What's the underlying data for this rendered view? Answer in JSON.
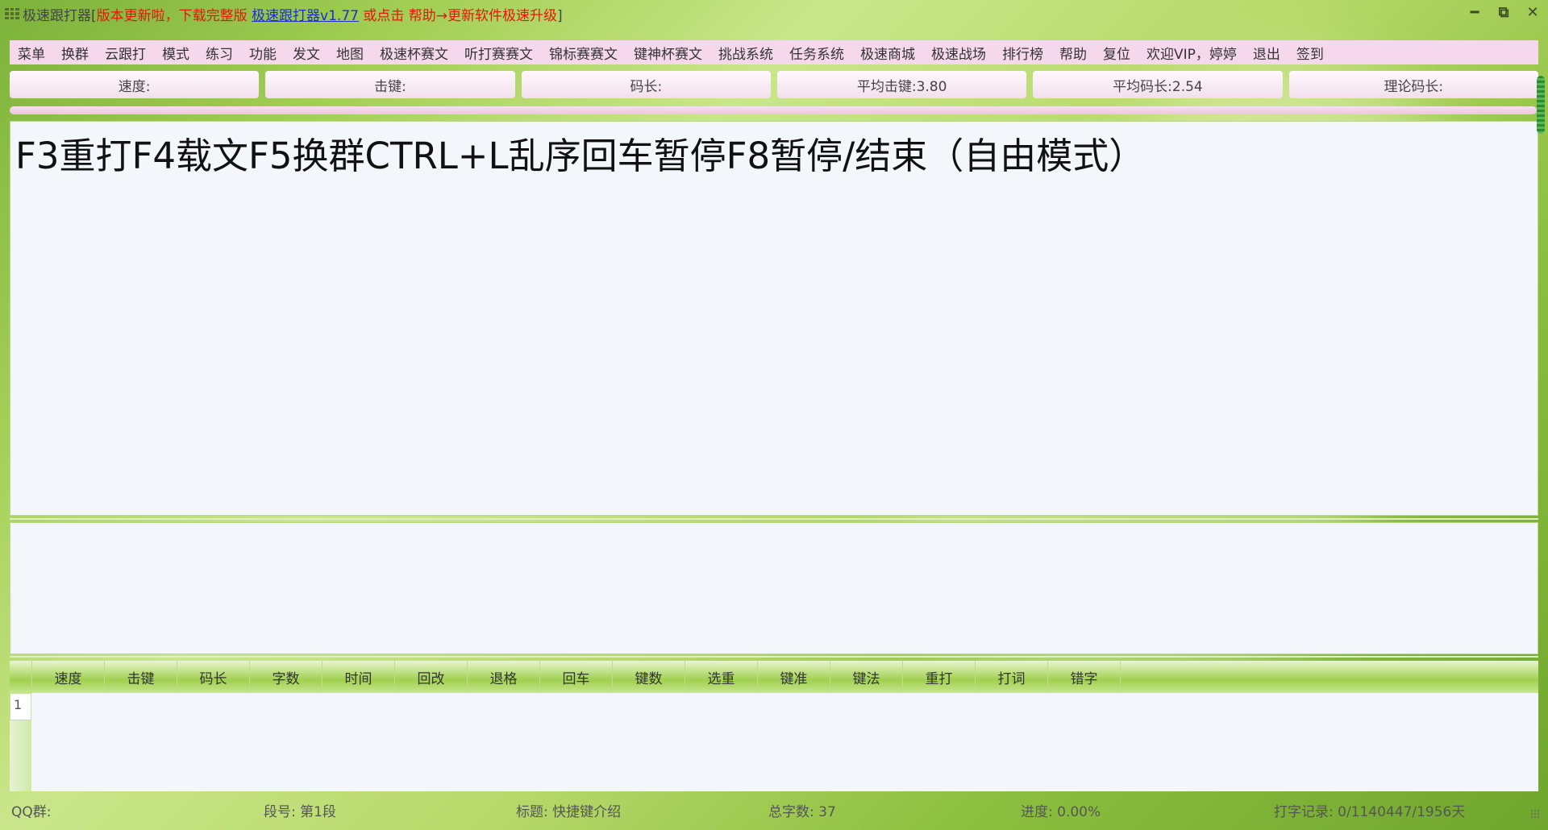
{
  "title": {
    "app": "极速跟打器",
    "bracket_open": "[",
    "notice": "版本更新啦，下载完整版",
    "link": "极速跟打器v1.77",
    "tail": "或点击 帮助→更新软件极速升级",
    "bracket_close": "]"
  },
  "menu": [
    "菜单",
    "换群",
    "云跟打",
    "模式",
    "练习",
    "功能",
    "发文",
    "地图",
    "极速杯赛文",
    "听打赛赛文",
    "锦标赛赛文",
    "键神杯赛文",
    "挑战系统",
    "任务系统",
    "极速商城",
    "极速战场",
    "排行榜",
    "帮助",
    "复位",
    "欢迎VIP，婷婷",
    "退出",
    "签到"
  ],
  "stats": [
    "速度:",
    "击键:",
    "码长:",
    "平均击键:3.80",
    "平均码长:2.54",
    "理论码长:"
  ],
  "text_display": "F3重打F4载文F5换群CTRL+L乱序回车暂停F8暂停/结束（自由模式）",
  "grid": {
    "columns": [
      "速度",
      "击键",
      "码长",
      "字数",
      "时间",
      "回改",
      "退格",
      "回车",
      "键数",
      "选重",
      "键准",
      "键法",
      "重打",
      "打词",
      "错字"
    ],
    "rows": [
      "1"
    ]
  },
  "status": {
    "qq": "QQ群:",
    "segment": "段号: 第1段",
    "title": "标题: 快捷键介绍",
    "total": "总字数: 37",
    "progress": "进度: 0.00%",
    "record": "打字记录: 0/1140447/1956天"
  },
  "colors": {
    "accent_red": "#e8140a",
    "link_blue": "#1a30c8",
    "menu_bg": "#f5d8ec"
  }
}
